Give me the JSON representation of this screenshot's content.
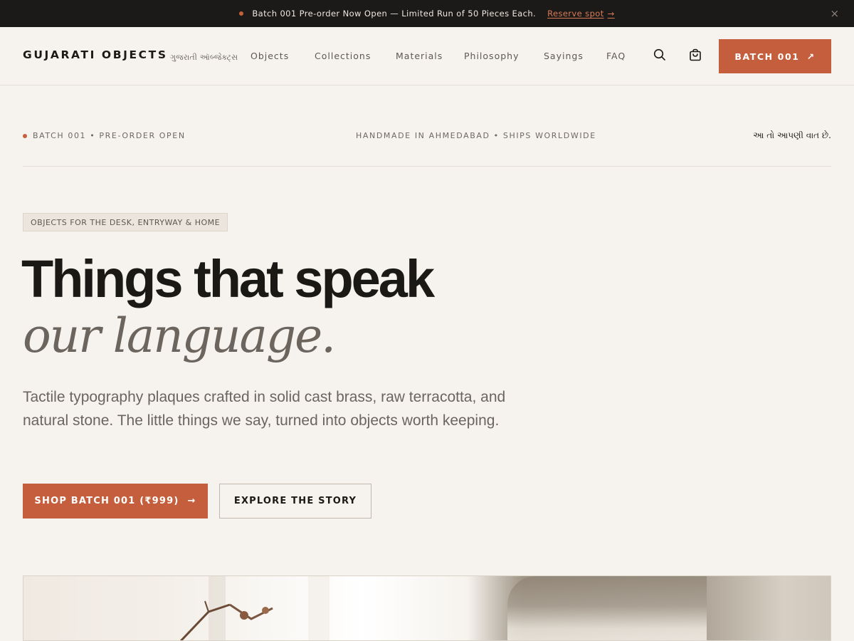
{
  "announcement": {
    "text": "Batch 001 Pre-order Now Open — Limited Run of 50 Pieces Each.",
    "link_label": "Reserve spot",
    "link_arrow": "→",
    "close_label": "×"
  },
  "header": {
    "logo": "GUJARATI OBJECTS",
    "logo_sub": "ગુજરાતી ઑબ્જેક્ટ્સ",
    "nav": [
      "Objects",
      "Collections",
      "Materials",
      "Philosophy",
      "Sayings",
      "FAQ"
    ],
    "cta_label": "BATCH 001",
    "cta_arrow": "↗"
  },
  "meta": {
    "left": "BATCH 001 • PRE-ORDER OPEN",
    "center": "HANDMADE IN AHMEDABAD • SHIPS WORLDWIDE",
    "right": "આ તો આપણી વાત છે."
  },
  "hero": {
    "tag": "OBJECTS FOR THE DESK, ENTRYWAY & HOME",
    "headline": "Things that speak",
    "headline_italic": "our language.",
    "lead": "Tactile typography plaques crafted in solid cast brass, raw terracotta, and natural stone. The little things we say, turned into objects worth keeping.",
    "primary_button": "SHOP BATCH 001 (₹999)",
    "primary_arrow": "→",
    "secondary_button": "EXPLORE THE STORY"
  },
  "colors": {
    "accent": "#c55e3c",
    "background": "#f6f3ef",
    "dark": "#1c1a18"
  },
  "icons": {
    "search": "search-icon",
    "cart": "shopping-bag-icon"
  }
}
